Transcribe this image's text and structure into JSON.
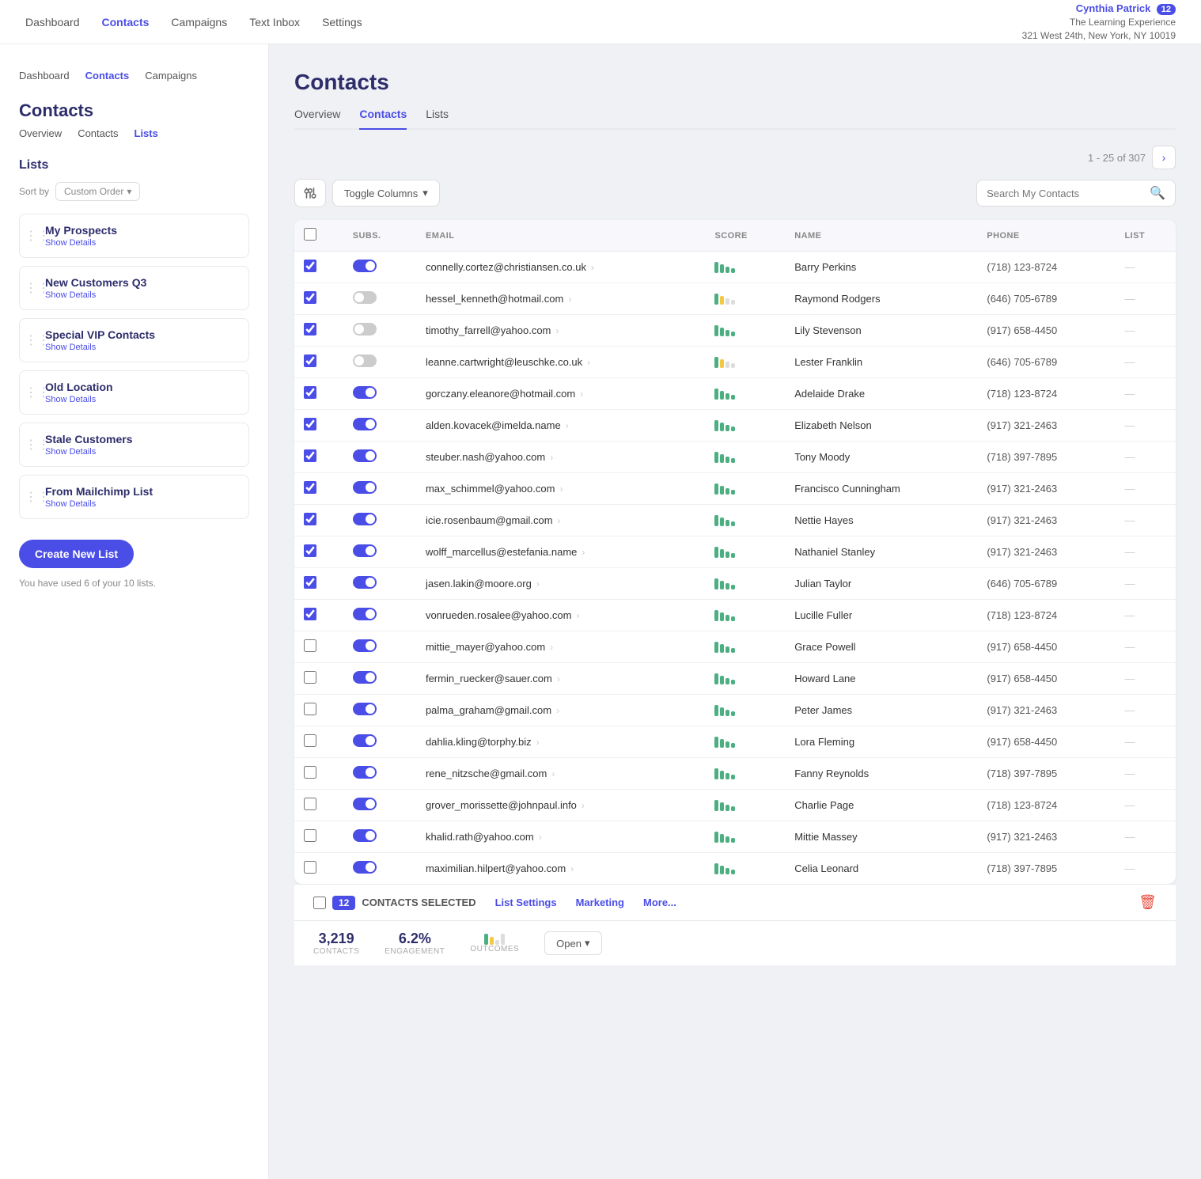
{
  "topNav": {
    "links": [
      "Dashboard",
      "Contacts",
      "Campaigns",
      "Text Inbox",
      "Settings"
    ],
    "activeLink": "Contacts",
    "user": {
      "name": "Cynthia Patrick",
      "badge": "12",
      "company": "The Learning Experience",
      "address": "321 West 24th, New York, NY 10019"
    }
  },
  "sidebar": {
    "miniNav": [
      "Dashboard",
      "Contacts",
      "Campaigns"
    ],
    "activeMiniNav": "Contacts",
    "title": "Contacts",
    "subNav": [
      "Overview",
      "Contacts",
      "Lists"
    ],
    "activeSubNav": "Lists",
    "listsTitle": "Lists",
    "sortLabel": "Sort by",
    "sortValue": "Custom Order",
    "lists": [
      {
        "name": "My Prospects",
        "detail": "Show Details"
      },
      {
        "name": "New Customers Q3",
        "detail": "Show Details"
      },
      {
        "name": "Special VIP Contacts",
        "detail": "Show Details"
      },
      {
        "name": "Old Location",
        "detail": "Show Details"
      },
      {
        "name": "Stale Customers",
        "detail": "Show Details"
      },
      {
        "name": "From Mailchimp List",
        "detail": "Show Details"
      }
    ],
    "createBtn": "Create New List",
    "listsLimitText": "You have used 6 of your 10 lists."
  },
  "main": {
    "title": "Contacts",
    "tabs": [
      "Overview",
      "Contacts",
      "Lists"
    ],
    "activeTab": "Contacts",
    "pagination": {
      "text": "1 - 25 of 307",
      "nextLabel": "›"
    },
    "toggleColumnsBtn": "Toggle Columns",
    "searchPlaceholder": "Search My Contacts",
    "tableHeaders": [
      "",
      "SUBS.",
      "EMAIL",
      "SCORE",
      "NAME",
      "PHONE",
      "LIST"
    ],
    "contacts": [
      {
        "checked": true,
        "subscribed": true,
        "email": "connelly.cortez@christiansen.co.uk",
        "scoreType": "high",
        "name": "Barry Perkins",
        "phone": "(718) 123-8724",
        "list": "—"
      },
      {
        "checked": true,
        "subscribed": false,
        "email": "hessel_kenneth@hotmail.com",
        "scoreType": "medium",
        "name": "Raymond Rodgers",
        "phone": "(646) 705-6789",
        "list": "—"
      },
      {
        "checked": true,
        "subscribed": false,
        "email": "timothy_farrell@yahoo.com",
        "scoreType": "high",
        "name": "Lily Stevenson",
        "phone": "(917) 658-4450",
        "list": "—"
      },
      {
        "checked": true,
        "subscribed": false,
        "email": "leanne.cartwright@leuschke.co.uk",
        "scoreType": "medium",
        "name": "Lester Franklin",
        "phone": "(646) 705-6789",
        "list": "—"
      },
      {
        "checked": true,
        "subscribed": true,
        "email": "gorczany.eleanore@hotmail.com",
        "scoreType": "high",
        "name": "Adelaide Drake",
        "phone": "(718) 123-8724",
        "list": "—"
      },
      {
        "checked": true,
        "subscribed": true,
        "email": "alden.kovacek@imelda.name",
        "scoreType": "high",
        "name": "Elizabeth Nelson",
        "phone": "(917) 321-2463",
        "list": "—"
      },
      {
        "checked": true,
        "subscribed": true,
        "email": "steuber.nash@yahoo.com",
        "scoreType": "high",
        "name": "Tony Moody",
        "phone": "(718) 397-7895",
        "list": "—"
      },
      {
        "checked": true,
        "subscribed": true,
        "email": "max_schimmel@yahoo.com",
        "scoreType": "high",
        "name": "Francisco Cunningham",
        "phone": "(917) 321-2463",
        "list": "—"
      },
      {
        "checked": true,
        "subscribed": true,
        "email": "icie.rosenbaum@gmail.com",
        "scoreType": "high",
        "name": "Nettie Hayes",
        "phone": "(917) 321-2463",
        "list": "—"
      },
      {
        "checked": true,
        "subscribed": true,
        "email": "wolff_marcellus@estefania.name",
        "scoreType": "high",
        "name": "Nathaniel Stanley",
        "phone": "(917) 321-2463",
        "list": "—"
      },
      {
        "checked": true,
        "subscribed": true,
        "email": "jasen.lakin@moore.org",
        "scoreType": "high",
        "name": "Julian Taylor",
        "phone": "(646) 705-6789",
        "list": "—"
      },
      {
        "checked": true,
        "subscribed": true,
        "email": "vonrueden.rosalee@yahoo.com",
        "scoreType": "high",
        "name": "Lucille Fuller",
        "phone": "(718) 123-8724",
        "list": "—"
      },
      {
        "checked": false,
        "subscribed": true,
        "email": "mittie_mayer@yahoo.com",
        "scoreType": "high",
        "name": "Grace Powell",
        "phone": "(917) 658-4450",
        "list": "—"
      },
      {
        "checked": false,
        "subscribed": true,
        "email": "fermin_ruecker@sauer.com",
        "scoreType": "high",
        "name": "Howard Lane",
        "phone": "(917) 658-4450",
        "list": "—"
      },
      {
        "checked": false,
        "subscribed": true,
        "email": "palma_graham@gmail.com",
        "scoreType": "high",
        "name": "Peter James",
        "phone": "(917) 321-2463",
        "list": "—"
      },
      {
        "checked": false,
        "subscribed": true,
        "email": "dahlia.kling@torphy.biz",
        "scoreType": "high",
        "name": "Lora Fleming",
        "phone": "(917) 658-4450",
        "list": "—"
      },
      {
        "checked": false,
        "subscribed": true,
        "email": "rene_nitzsche@gmail.com",
        "scoreType": "high",
        "name": "Fanny Reynolds",
        "phone": "(718) 397-7895",
        "list": "—"
      },
      {
        "checked": false,
        "subscribed": true,
        "email": "grover_morissette@johnpaul.info",
        "scoreType": "high",
        "name": "Charlie Page",
        "phone": "(718) 123-8724",
        "list": "—"
      },
      {
        "checked": false,
        "subscribed": true,
        "email": "khalid.rath@yahoo.com",
        "scoreType": "high",
        "name": "Mittie Massey",
        "phone": "(917) 321-2463",
        "list": "—"
      },
      {
        "checked": false,
        "subscribed": true,
        "email": "maximilian.hilpert@yahoo.com",
        "scoreType": "high",
        "name": "Celia Leonard",
        "phone": "(718) 397-7895",
        "list": "—"
      }
    ],
    "bottomBar": {
      "selectedCount": "12",
      "selectedLabel": "CONTACTS SELECTED",
      "actions": [
        "List Settings",
        "Marketing",
        "More..."
      ],
      "deleteIcon": "🗑"
    },
    "statsBar": {
      "contacts": {
        "value": "3,219",
        "label": "CONTACTS"
      },
      "engagement": {
        "value": "6.2%",
        "label": "ENGAGEMENT"
      },
      "outcomes": {
        "label": "OUTCOMES"
      },
      "openBtn": "Open"
    }
  }
}
